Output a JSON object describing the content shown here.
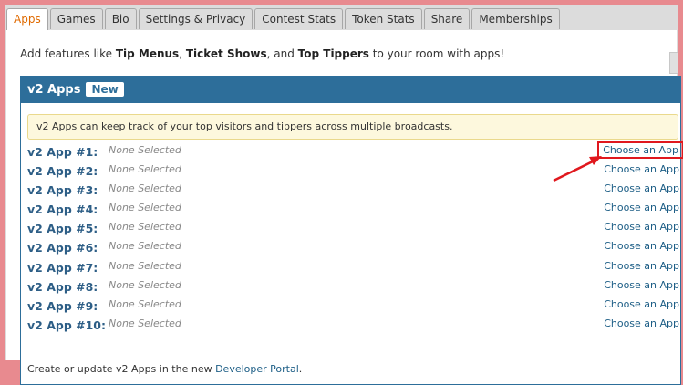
{
  "tabs": [
    {
      "label": "Apps",
      "active": true
    },
    {
      "label": "Games"
    },
    {
      "label": "Bio"
    },
    {
      "label": "Settings & Privacy"
    },
    {
      "label": "Contest Stats"
    },
    {
      "label": "Token Stats"
    },
    {
      "label": "Share"
    },
    {
      "label": "Memberships"
    }
  ],
  "intro": {
    "prefix": "Add features like ",
    "bold1": "Tip Menus",
    "sep1": ", ",
    "bold2": "Ticket Shows",
    "sep2": ", and ",
    "bold3": "Top Tippers",
    "suffix": " to your room with apps!"
  },
  "box": {
    "title": "v2 Apps",
    "badge": "New",
    "notice": "v2 Apps can keep track of your top visitors and tippers across multiple broadcasts."
  },
  "apps": [
    {
      "label": "v2 App #1:",
      "value": "None Selected",
      "link": "Choose an App"
    },
    {
      "label": "v2 App #2:",
      "value": "None Selected",
      "link": "Choose an App"
    },
    {
      "label": "v2 App #3:",
      "value": "None Selected",
      "link": "Choose an App"
    },
    {
      "label": "v2 App #4:",
      "value": "None Selected",
      "link": "Choose an App"
    },
    {
      "label": "v2 App #5:",
      "value": "None Selected",
      "link": "Choose an App"
    },
    {
      "label": "v2 App #6:",
      "value": "None Selected",
      "link": "Choose an App"
    },
    {
      "label": "v2 App #7:",
      "value": "None Selected",
      "link": "Choose an App"
    },
    {
      "label": "v2 App #8:",
      "value": "None Selected",
      "link": "Choose an App"
    },
    {
      "label": "v2 App #9:",
      "value": "None Selected",
      "link": "Choose an App"
    },
    {
      "label": "v2 App #10:",
      "value": "None Selected",
      "link": "Choose an App"
    }
  ],
  "footer": {
    "text": "Create or update v2 Apps in the new ",
    "link": "Developer Portal",
    "end": "."
  },
  "colors": {
    "accent": "#2d6e9a",
    "highlight": "#e0181e",
    "active_tab": "#e06a00"
  }
}
